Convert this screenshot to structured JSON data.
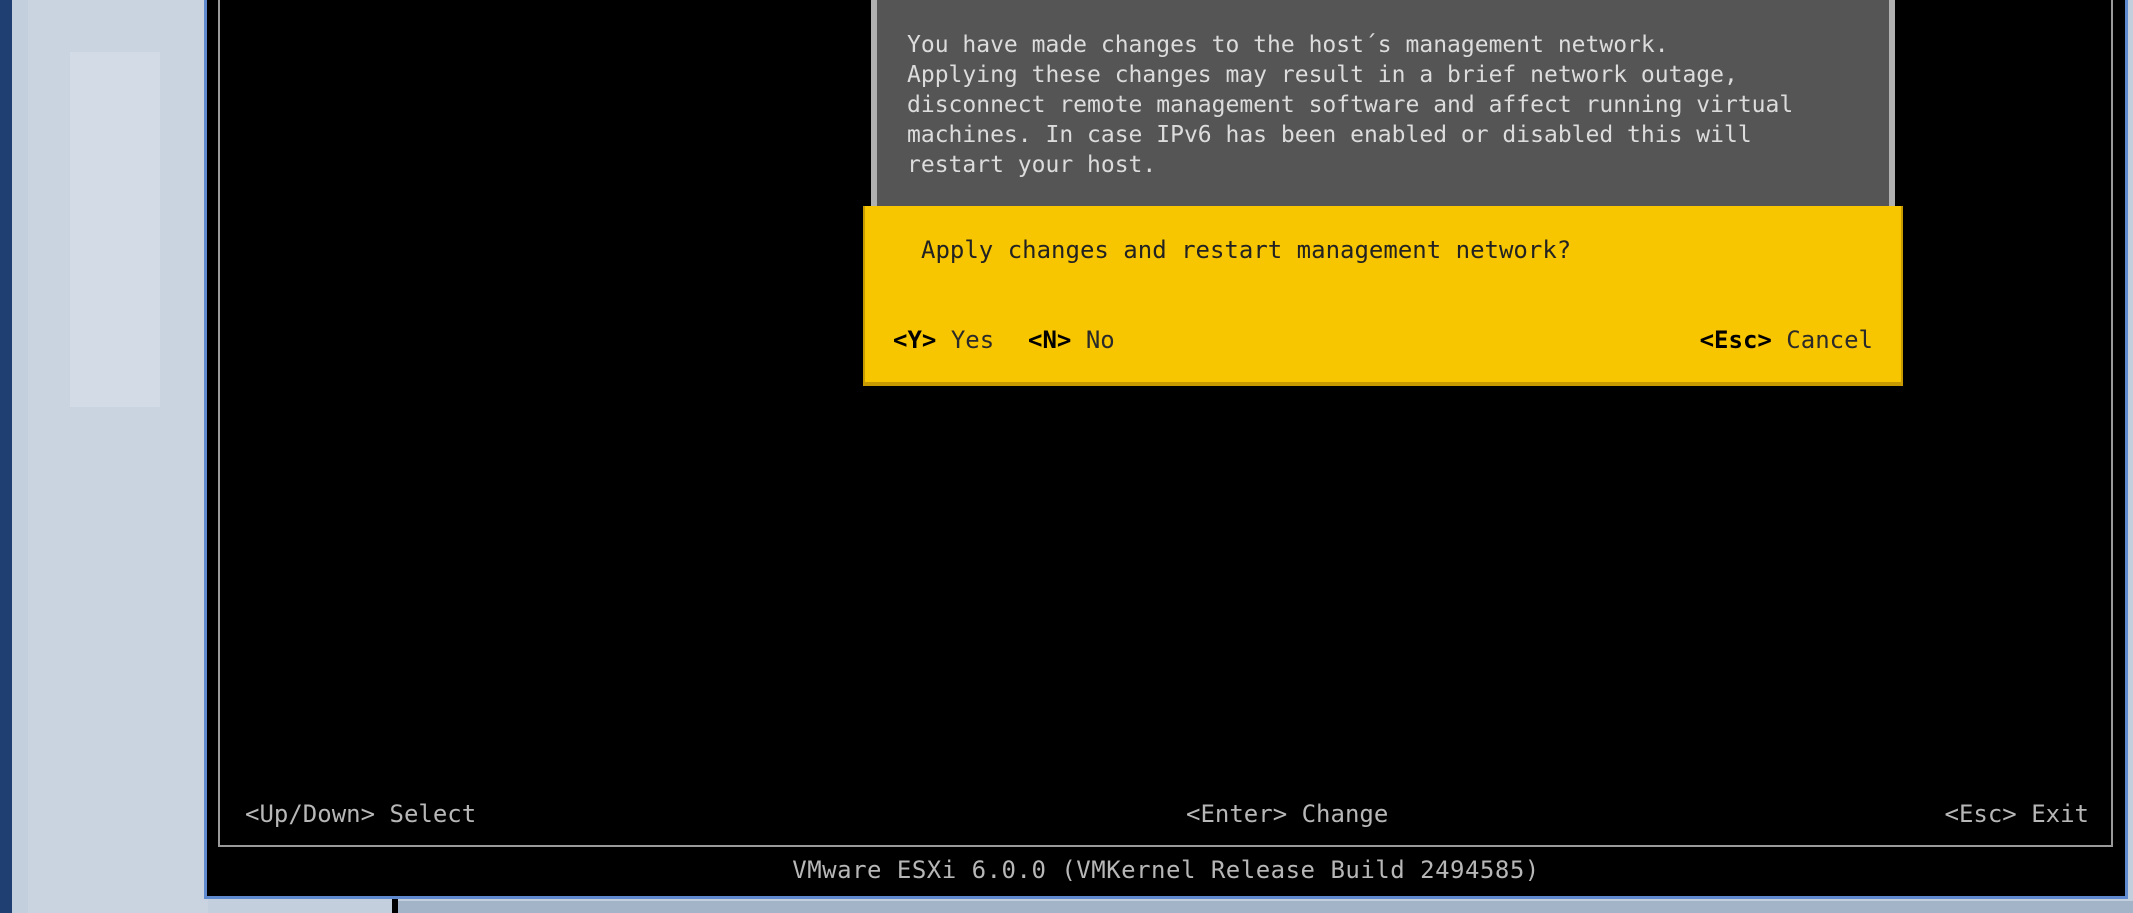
{
  "dialog": {
    "message": "You have made changes to the host´s management network.\nApplying these changes may result in a brief network outage,\ndisconnect remote management software and affect running virtual\nmachines. In case IPv6 has been enabled or disabled this will\nrestart your host.",
    "question": "Apply changes and restart management network?",
    "yes_key": "<Y>",
    "yes_label": "Yes",
    "no_key": "<N>",
    "no_label": "No",
    "cancel_key": "<Esc>",
    "cancel_label": "Cancel"
  },
  "footer": {
    "select_hint": "<Up/Down> Select",
    "change_hint": "<Enter> Change",
    "exit_hint": "<Esc> Exit"
  },
  "version": "VMware ESXi 6.0.0 (VMKernel Release Build 2494585)",
  "colors": {
    "dialog_accent": "#f8c600",
    "message_bg": "#555555",
    "console_bg": "#000000",
    "console_text": "#b7b7b7"
  }
}
